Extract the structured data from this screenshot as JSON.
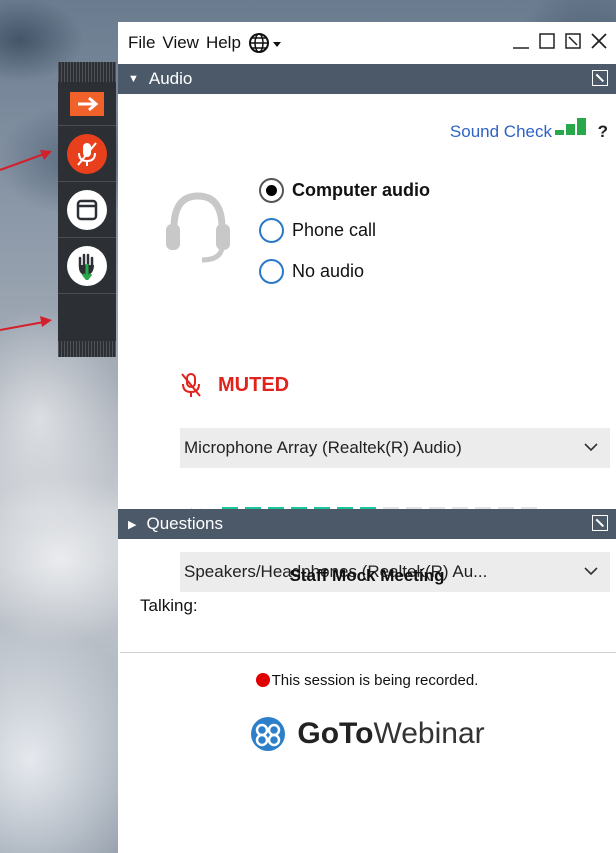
{
  "menu": {
    "file": "File",
    "view": "View",
    "help": "Help"
  },
  "audio_panel": {
    "title": "Audio",
    "sound_check": "Sound Check",
    "help": "?",
    "options": [
      {
        "label": "Computer audio",
        "selected": true
      },
      {
        "label": "Phone call",
        "selected": false
      },
      {
        "label": "No audio",
        "selected": false
      }
    ],
    "mute_status": "MUTED",
    "microphone": "Microphone Array (Realtek(R) Audio)",
    "speaker": "Speakers/Headphones  (Realtek(R)  Au...",
    "speaker_level_fraction": 0.5,
    "talking_label": "Talking:"
  },
  "questions_panel": {
    "title": "Questions",
    "meeting_name": "Staff Mock Meeting",
    "recording_notice": "This session is being recorded.",
    "brand_goto": "GoTo",
    "brand_webinar": "Webinar"
  },
  "colors": {
    "header": "#4b5968",
    "accent_red": "#e8401c",
    "link_blue": "#2f62c7",
    "level_green": "#19c69a",
    "muted_red": "#e0231c"
  },
  "icons": [
    "orange-arrow-icon",
    "muted-mic-icon",
    "window-icon",
    "raise-hand-icon",
    "headset-icon",
    "globe-icon",
    "speaker-icon"
  ]
}
